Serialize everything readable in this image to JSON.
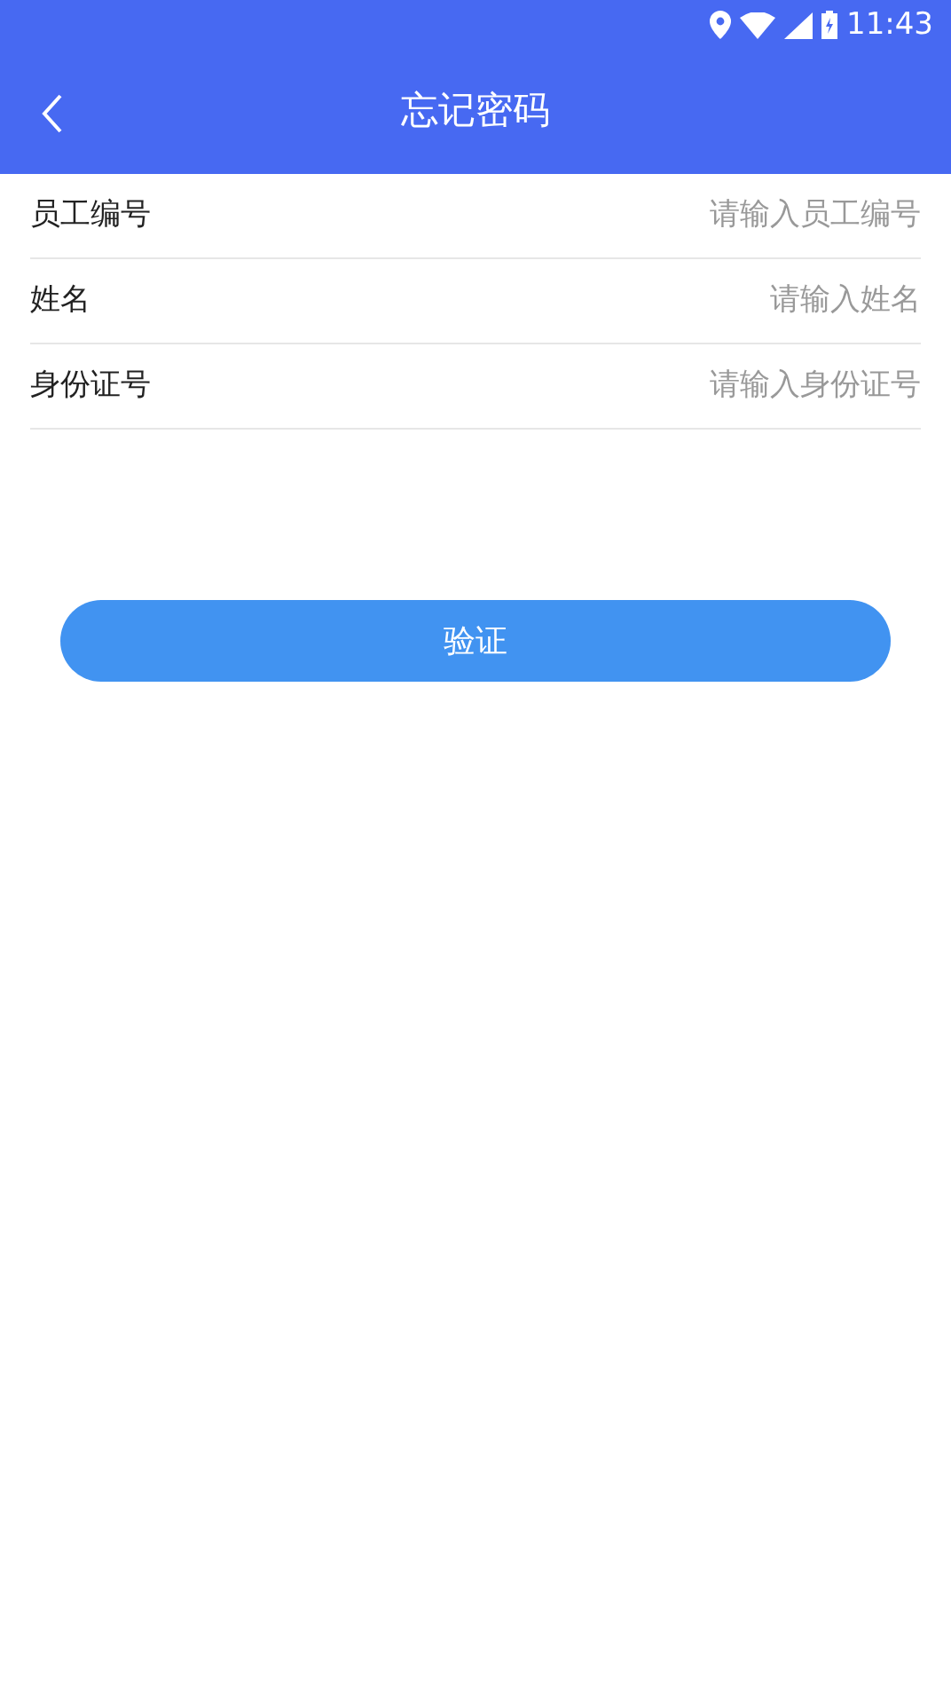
{
  "status_bar": {
    "time": "11:43"
  },
  "header": {
    "title": "忘记密码"
  },
  "fields": [
    {
      "label": "员工编号",
      "placeholder": "请输入员工编号"
    },
    {
      "label": "姓名",
      "placeholder": "请输入姓名"
    },
    {
      "label": "身份证号",
      "placeholder": "请输入身份证号"
    }
  ],
  "submit_button": {
    "label": "验证"
  }
}
